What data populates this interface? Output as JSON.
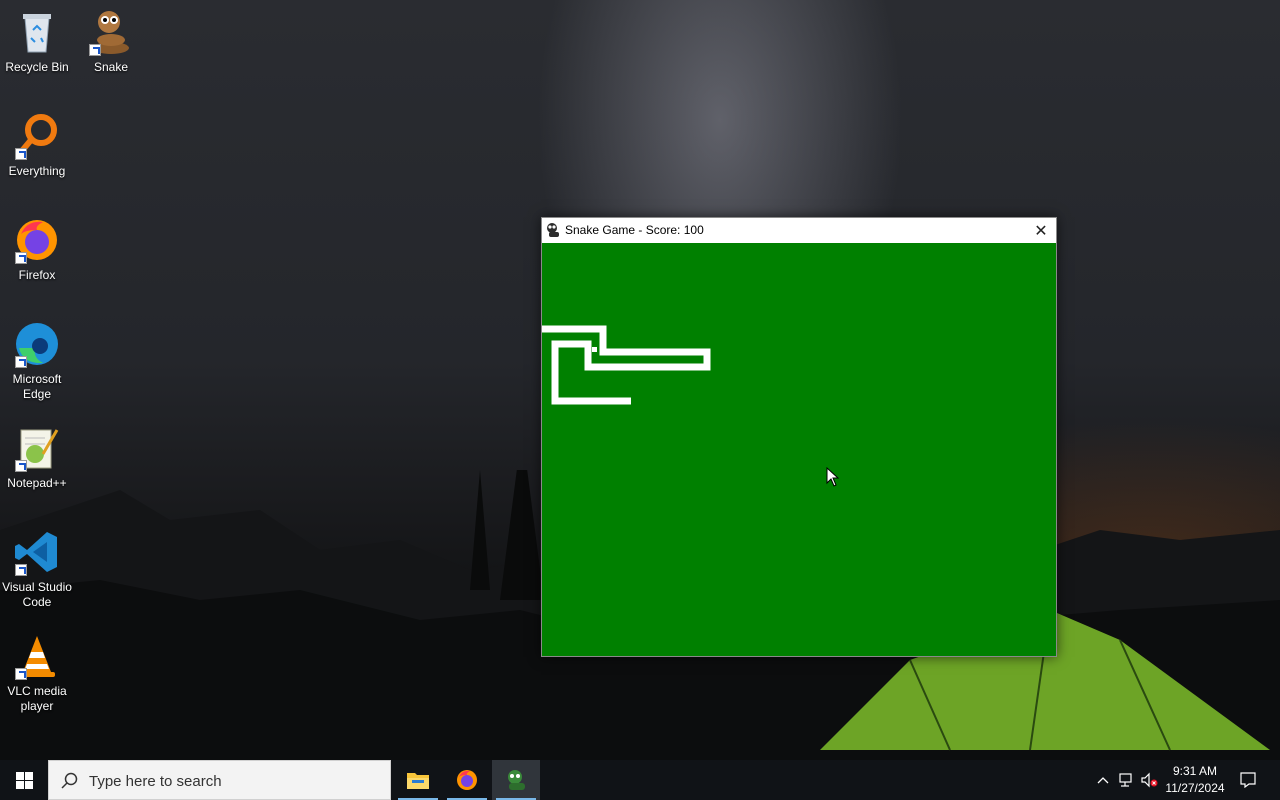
{
  "desktop": {
    "icons": [
      {
        "label": "Recycle Bin",
        "icon": "recycle-bin-icon"
      },
      {
        "label": "Snake",
        "icon": "snake-icon"
      },
      {
        "label": "Everything",
        "icon": "everything-search-icon"
      },
      {
        "label": "Firefox",
        "icon": "firefox-icon"
      },
      {
        "label": "Microsoft Edge",
        "icon": "edge-icon"
      },
      {
        "label": "Notepad++",
        "icon": "notepadpp-icon"
      },
      {
        "label": "Visual Studio Code",
        "icon": "vscode-icon"
      },
      {
        "label": "VLC media player",
        "icon": "vlc-icon"
      }
    ]
  },
  "window": {
    "title": "Snake Game - Score: 100",
    "close_label": "✕",
    "game": {
      "background": "#008000",
      "snake_color": "#ffffff"
    }
  },
  "taskbar": {
    "search_placeholder": "Type here to search",
    "apps": [
      {
        "name": "File Explorer",
        "icon": "file-explorer-icon"
      },
      {
        "name": "Firefox",
        "icon": "firefox-icon"
      },
      {
        "name": "Snake Game",
        "icon": "snake-icon",
        "active": true
      }
    ],
    "clock": {
      "time": "9:31 AM",
      "date": "11/27/2024"
    }
  }
}
